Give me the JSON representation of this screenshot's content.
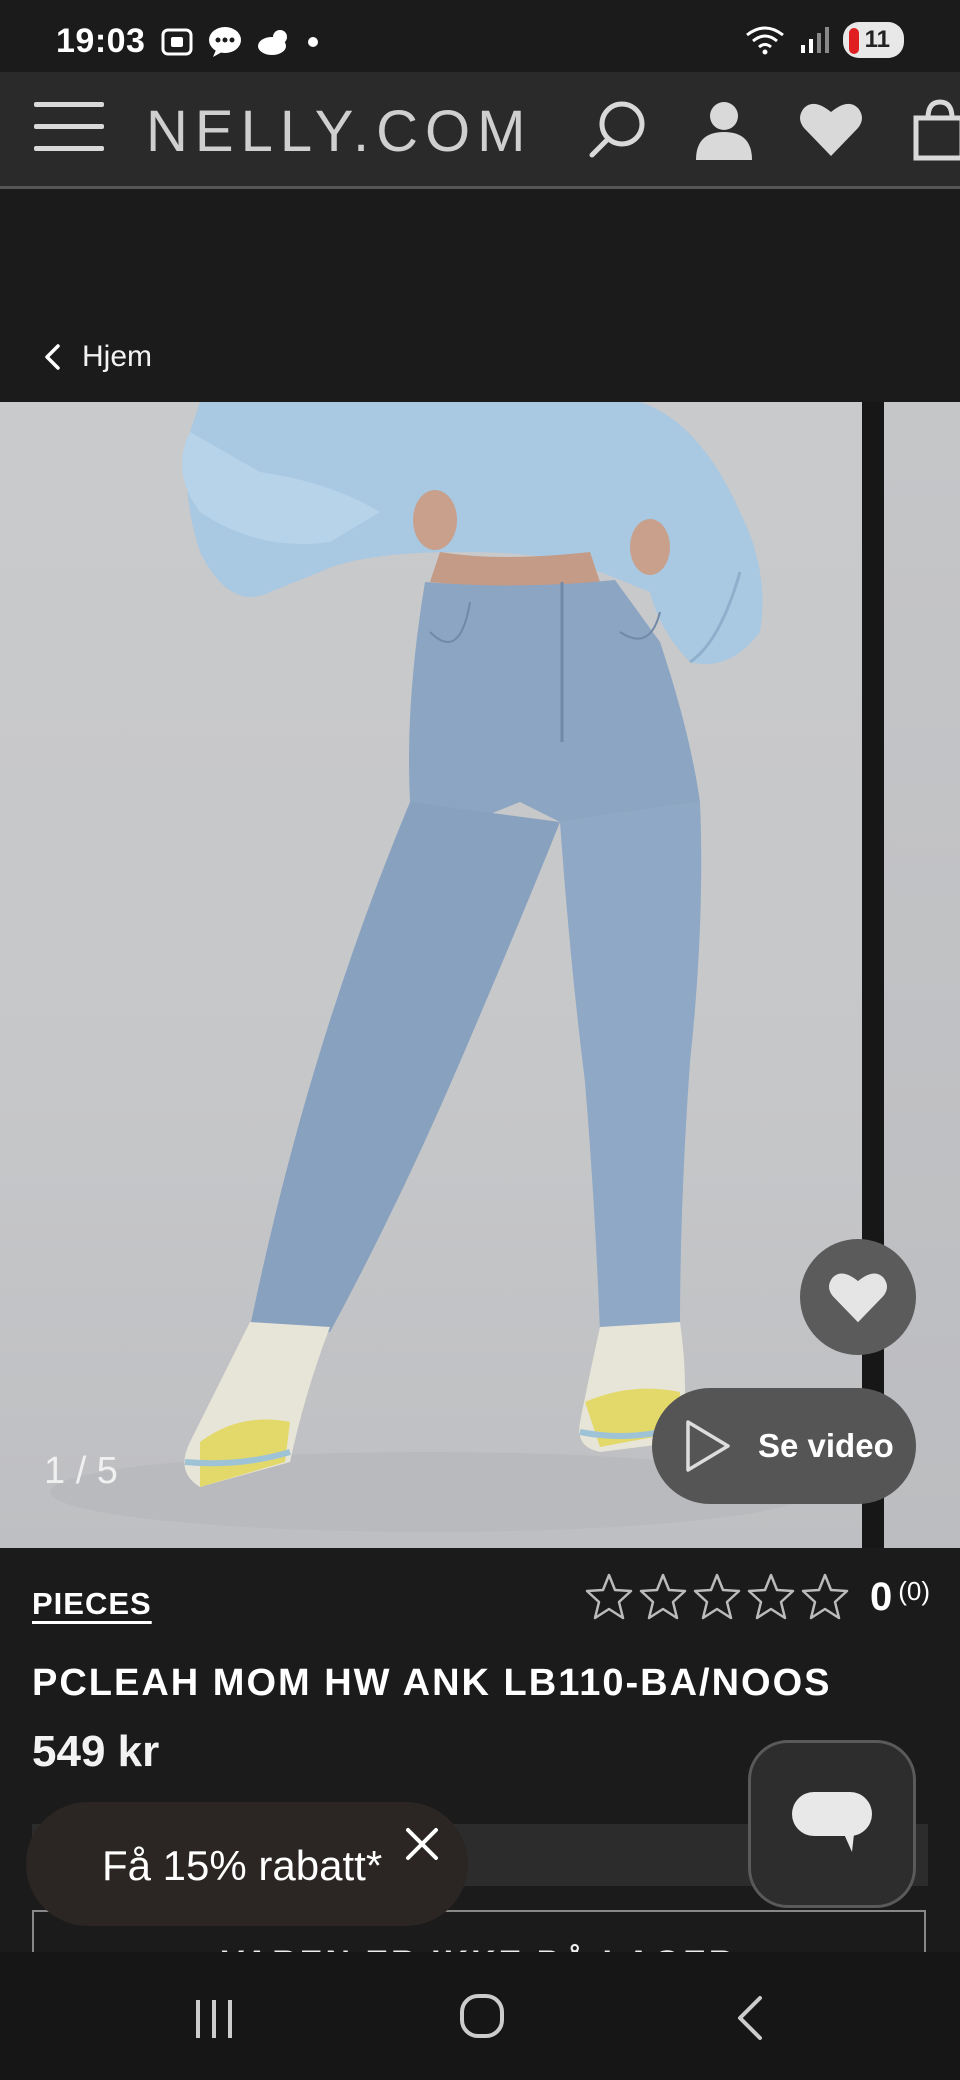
{
  "status_bar": {
    "time": "19:03",
    "battery": "11",
    "icons_left": [
      "screenshot-icon",
      "chat-bubble-icon",
      "cloud-weather-icon",
      "dot-icon"
    ],
    "icons_right": [
      "wifi-icon",
      "signal-icon",
      "battery-icon"
    ]
  },
  "header": {
    "logo": "NELLY.COM",
    "icons": [
      "menu-icon",
      "search-icon",
      "account-icon",
      "heart-icon",
      "cart-icon"
    ]
  },
  "breadcrumb": {
    "label": "Hjem"
  },
  "gallery": {
    "counter": "1 / 5",
    "video_label": "Se video"
  },
  "product": {
    "brand": "PIECES",
    "title": "PCLEAH MOM HW ANK LB110-BA/NOOS",
    "price": "549 kr",
    "rating_value": "0",
    "rating_count": "(0)",
    "stars_filled": 0,
    "stars_total": 5,
    "stock_label": "VAREN ER IKKE PÅ LAGER"
  },
  "promo": {
    "discount_label": "Få 15% rabatt*"
  },
  "colors": {
    "background": "#1b1b1c",
    "header_bg": "#2a2a2b",
    "photo_bg": "#c9cacc",
    "denim": "#8aa3c0",
    "sweater": "#a8c7e0"
  }
}
